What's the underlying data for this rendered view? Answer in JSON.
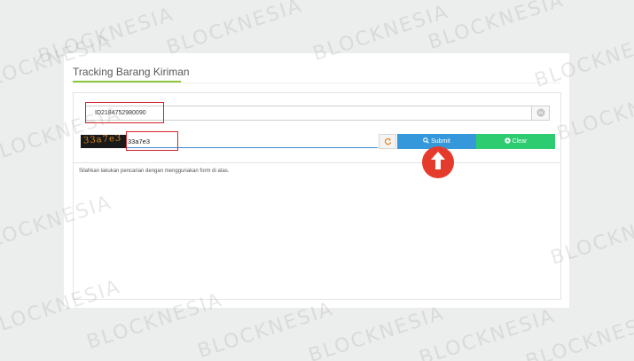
{
  "card": {
    "title": "Tracking Barang Kiriman"
  },
  "form": {
    "tracking_value": "ID2184752980090",
    "captcha_image_text": "33a7e3",
    "captcha_value": "33a7e3",
    "submit_label": "Submit",
    "clear_label": "Clear"
  },
  "result": {
    "message": "Silahkan lakukan pencarian dengan menggunakan form di atas."
  },
  "watermark": {
    "text": "BLOCKNESIA"
  },
  "colors": {
    "accent_green_underline": "#8cc63f",
    "submit_blue": "#3498db",
    "clear_green": "#2ecc71",
    "highlight_red": "#d3222a",
    "arrow_red": "#e53b2c",
    "captcha_orange": "#e08a1e"
  },
  "icons": {
    "track_addon": "fingerprint-icon",
    "refresh": "refresh-icon",
    "submit": "search-icon",
    "clear": "recycle-icon",
    "annotation": "arrow-up-icon"
  }
}
